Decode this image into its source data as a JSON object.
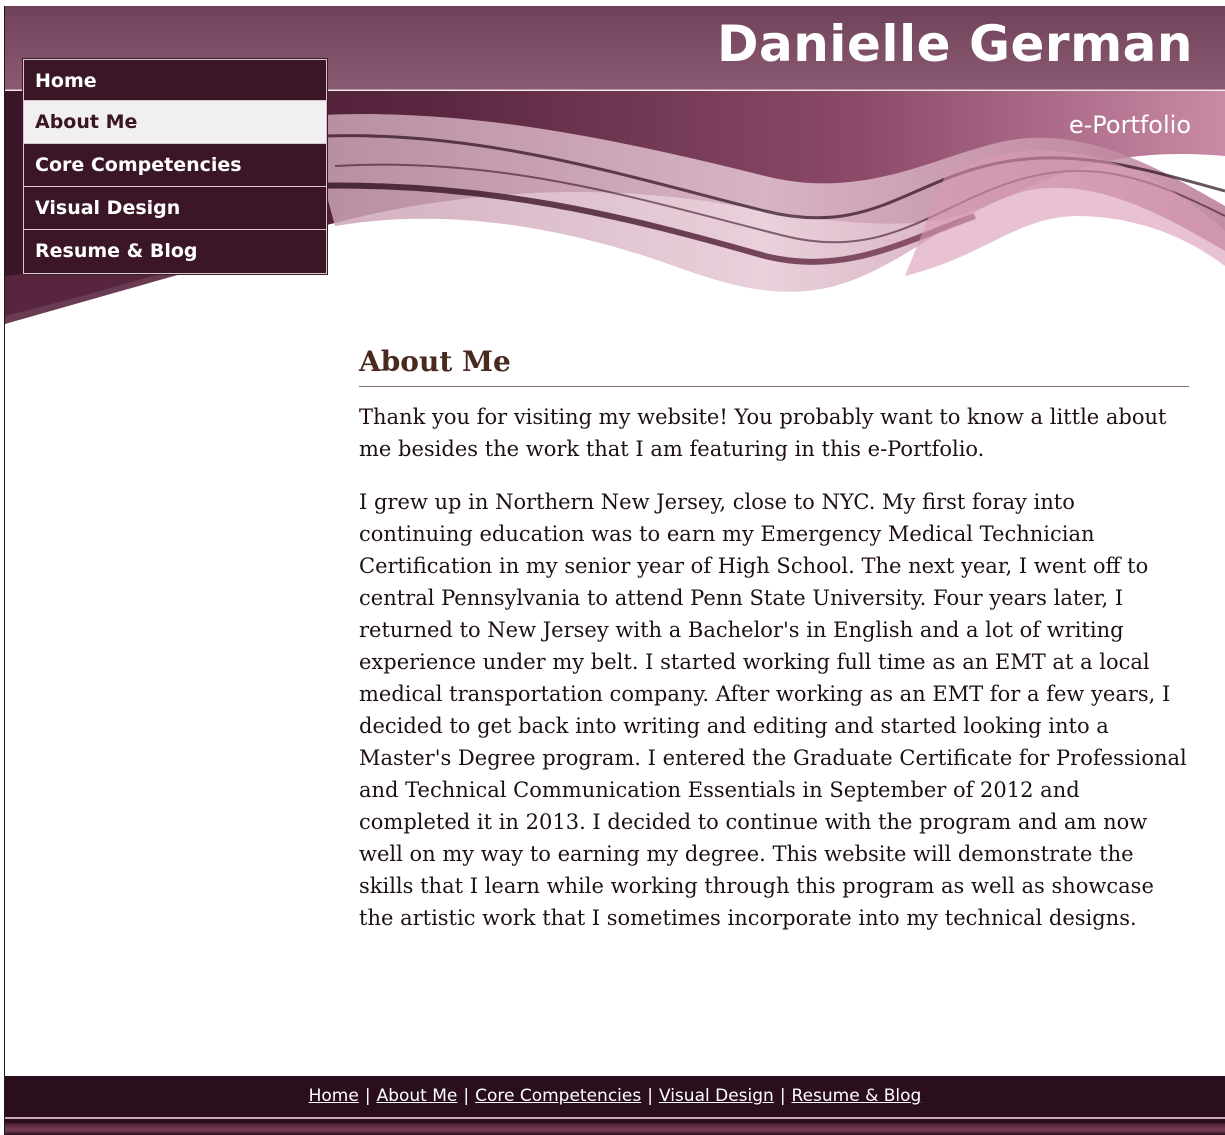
{
  "site": {
    "title": "Danielle German",
    "subtitle": "e-Portfolio"
  },
  "nav": {
    "items": [
      {
        "label": "Home",
        "active": false
      },
      {
        "label": "About Me",
        "active": true
      },
      {
        "label": "Core Competencies",
        "active": false
      },
      {
        "label": "Visual Design",
        "active": false
      },
      {
        "label": "Resume & Blog",
        "active": false
      }
    ]
  },
  "main": {
    "heading": "About Me",
    "paragraphs": [
      "Thank you for visiting my website!  You probably want to know a little about me besides the work that I am featuring in this e-Portfolio.",
      "I grew up in Northern New Jersey, close to NYC.  My first foray into continuing education was to earn my Emergency Medical Technician Certification in my senior year of High School.  The next year, I went off to central Pennsylvania to attend Penn State University.  Four years later, I returned to New Jersey with a Bachelor's in English and a lot of writing experience under my belt.  I started working full time as an EMT at a local medical transportation company.  After working as an EMT for a few years, I decided to get back into writing and editing and started looking into a Master's Degree program.  I entered the Graduate Certificate for Professional and Technical Communication Essentials in September of 2012 and completed it in 2013.  I decided to continue with the program and am now well on my way to earning my degree.  This website will  demonstrate the skills that I learn while working through this program as well as showcase the artistic work that I sometimes incorporate into my technical designs."
    ]
  },
  "footer": {
    "links": [
      "Home",
      "About Me",
      "Core Competencies",
      "Visual Design",
      "Resume & Blog"
    ],
    "separator": "|"
  },
  "colors": {
    "header_band": "#7b4a62",
    "nav_bg": "#3a1626",
    "nav_active_bg": "#f1eff0",
    "heading": "#4a2a1e",
    "footer_bg": "#2a0e1d"
  }
}
